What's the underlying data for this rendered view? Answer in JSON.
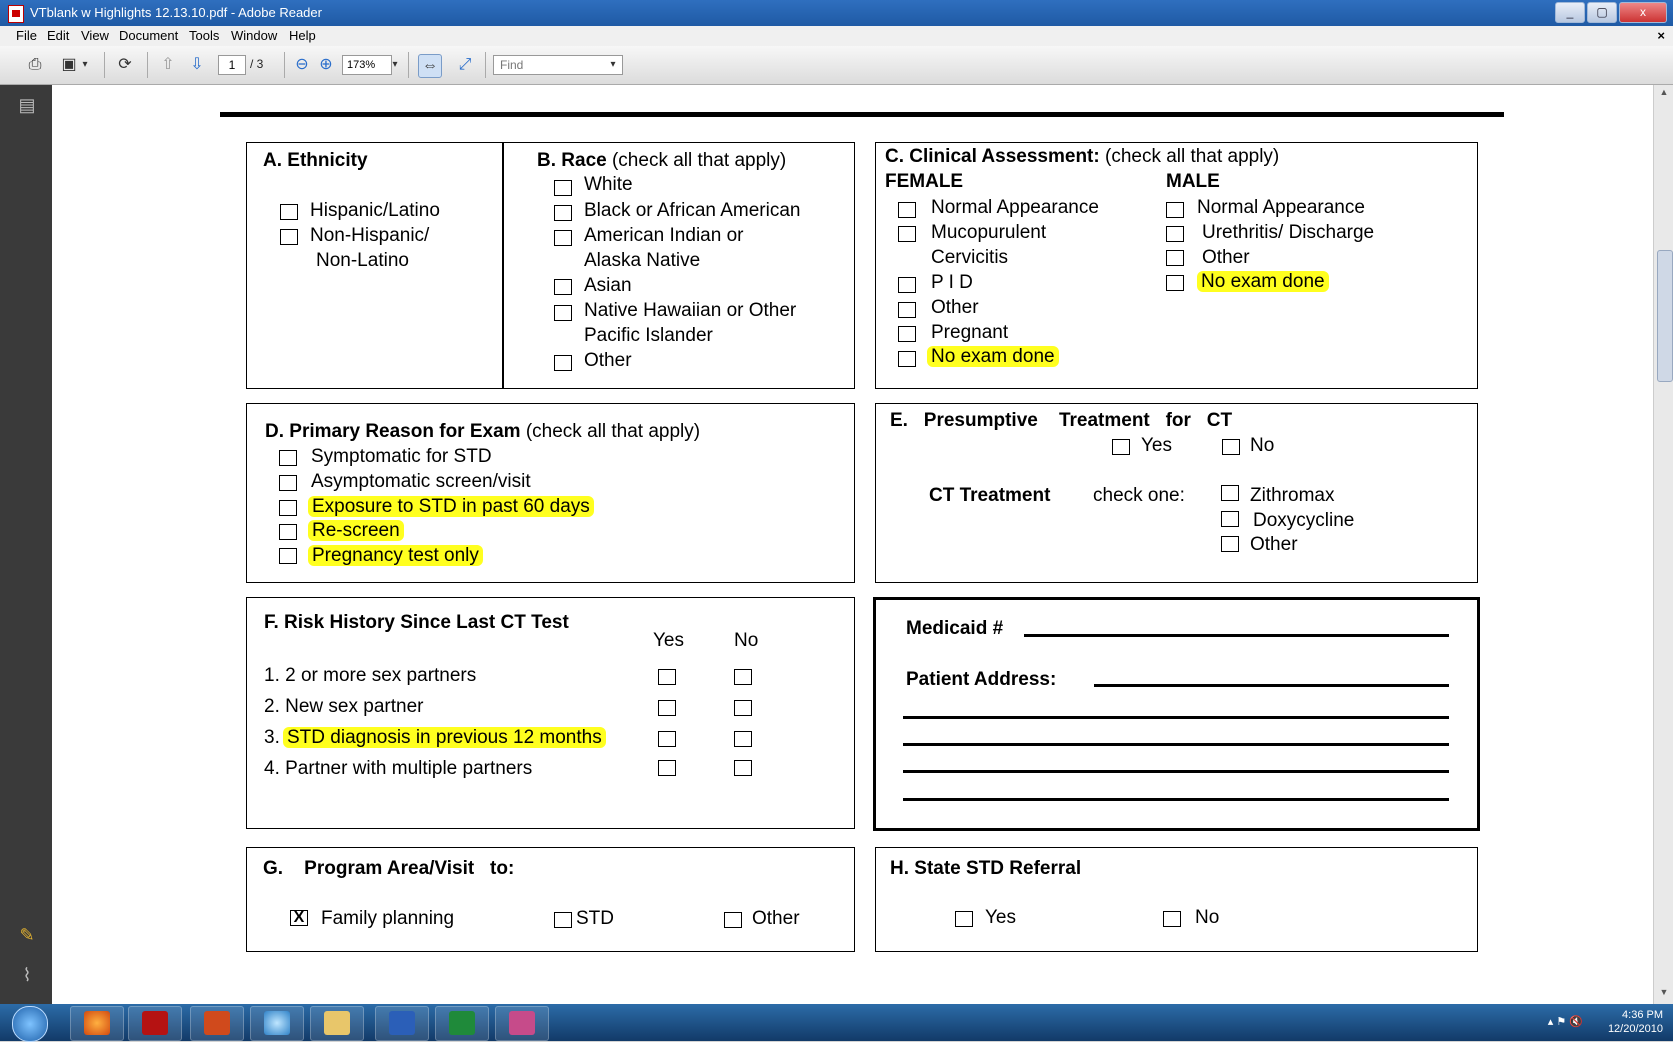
{
  "window": {
    "title": "VTblank w Highlights 12.13.10.pdf - Adobe Reader",
    "controls": [
      "_",
      "▢",
      "x"
    ]
  },
  "menu": {
    "items": [
      "File",
      "Edit",
      "View",
      "Document",
      "Tools",
      "Window",
      "Help"
    ],
    "close": "×"
  },
  "toolbar": {
    "page_current": "1",
    "page_total": "/ 3",
    "zoom": "173%",
    "find_placeholder": "Find"
  },
  "form": {
    "a": {
      "title": "A. Ethnicity",
      "options": [
        "Hispanic/Latino",
        "Non-Hispanic/",
        "Non-Latino"
      ]
    },
    "b": {
      "title": "B. Race",
      "title_note": "(check all that apply)",
      "options": [
        "White",
        "Black or African American",
        "American Indian or",
        "Alaska Native",
        "Asian",
        "Native Hawaiian or Other",
        "Pacific Islander",
        "Other"
      ]
    },
    "c": {
      "title": "C.  Clinical Assessment:",
      "title_note": "(check all that apply)",
      "female_label": "FEMALE",
      "male_label": "MALE",
      "female": [
        "Normal Appearance",
        "Mucopurulent",
        "Cervicitis",
        "P I D",
        "Other",
        "Pregnant",
        "No exam done"
      ],
      "male": [
        "Normal Appearance",
        "Urethritis/ Discharge",
        "Other",
        "No exam done"
      ]
    },
    "d": {
      "title": "D.  Primary Reason for Exam",
      "title_note": "(check all that apply)",
      "options": [
        "Symptomatic for STD",
        "Asymptomatic screen/visit",
        "Exposure to STD in past 60 days",
        "Re-screen",
        "Pregnancy test only"
      ]
    },
    "e": {
      "title": "E.   Presumptive    Treatment   for   CT",
      "yes": "Yes",
      "no": "No",
      "ct_label": "CT Treatment",
      "check_one": "check one:",
      "options": [
        "Zithromax",
        "Doxycycline",
        "Other"
      ]
    },
    "f": {
      "title": "F.  Risk History Since Last CT Test",
      "yes": "Yes",
      "no": "No",
      "items": [
        "1. 2 or more sex partners",
        "2. New sex partner",
        "3.",
        "STD diagnosis in previous 12 months",
        "4. Partner with multiple partners"
      ]
    },
    "medicaid": {
      "medicaid_label": "Medicaid #",
      "address_label": "Patient Address:"
    },
    "g": {
      "title": "G.    Program Area/Visit   to:",
      "check_mark": "X",
      "options": [
        "Family planning",
        "STD",
        "Other"
      ]
    },
    "h": {
      "title": "H.  State STD Referral",
      "yes": "Yes",
      "no": "No"
    }
  },
  "taskbar": {
    "time": "4:36 PM",
    "date": "12/20/2010"
  },
  "colors": {
    "highlight": "#ffff1f",
    "titlebar": "#1f5aa5",
    "leftpanel": "#3a3a3a"
  }
}
